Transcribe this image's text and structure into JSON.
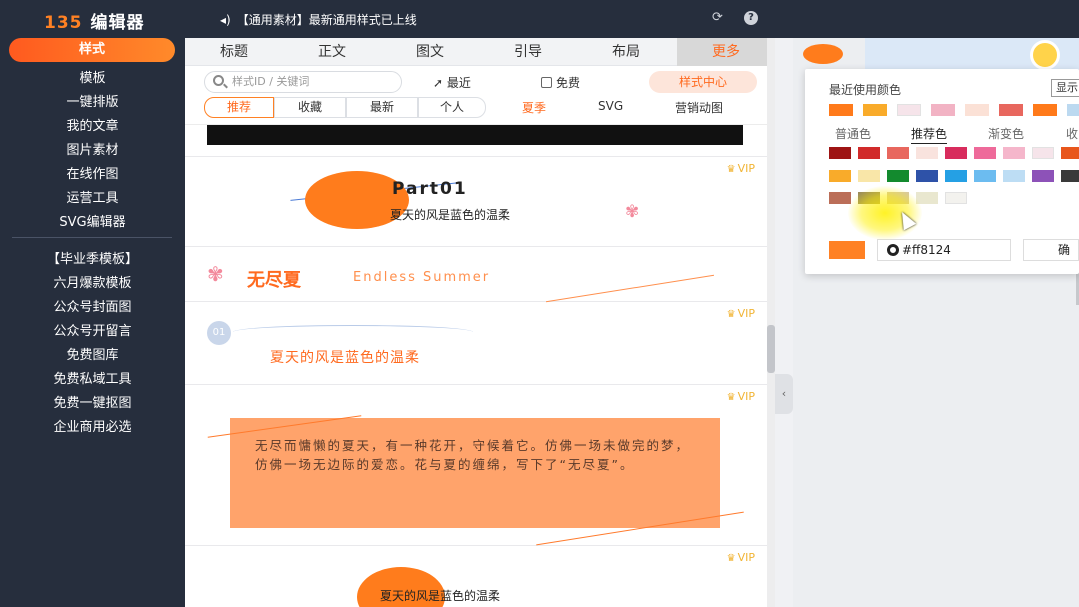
{
  "app": {
    "logo": "135",
    "title": "编辑器",
    "notice_icon": "speaker-icon",
    "notice": "【通用素材】最新通用样式已上线"
  },
  "sidebar": {
    "items": [
      "样式",
      "模板",
      "一键排版",
      "我的文章",
      "图片素材",
      "在线作图",
      "运营工具",
      "SVG编辑器"
    ],
    "items2": [
      "【毕业季模板】",
      "六月爆款模板",
      "公众号封面图",
      "公众号开留言",
      "免费图库",
      "免费私域工具",
      "免费一键抠图",
      "企业商用必选"
    ]
  },
  "panel": {
    "tabs": [
      "标题",
      "正文",
      "图文",
      "引导",
      "布局",
      "更多"
    ],
    "search_placeholder": "样式ID / 关键词",
    "recent": "最近",
    "free": "免费",
    "style_center": "样式中心",
    "subtabs": [
      "推荐",
      "收藏",
      "最新",
      "个人"
    ],
    "subtexts": [
      "夏季",
      "SVG",
      "营销动图"
    ]
  },
  "cards": {
    "vip": "VIP",
    "part01": {
      "title": "Part01",
      "subtitle": "夏天的风是蓝色的温柔"
    },
    "endless": {
      "cn": "无尽夏",
      "en": "Endless Summer"
    },
    "num1": {
      "badge": "01",
      "text": "夏天的风是蓝色的温柔"
    },
    "box": {
      "text": "无尽而慵懒的夏天，有一种花开，守候着它。仿佛一场未做完的梦，仿佛一场无边际的爱恋。花与夏的缠绵，写下了“无尽夏”。"
    },
    "last": {
      "text": "夏天的风是蓝色的温柔"
    }
  },
  "picker": {
    "recent_label": "最近使用颜色",
    "show_label": "显示",
    "tabs": [
      "普通色",
      "推荐色",
      "渐变色",
      "收"
    ],
    "current_hex": "#ff8124",
    "confirm": "确"
  },
  "colors": {
    "accent": "#ff8124",
    "recent": [
      "#ff7a1a",
      "#f9ab2a",
      "#f6e4ea",
      "#f2b3c4",
      "#fbe1d6",
      "#e8675e",
      "#ff7a1a",
      "#bcd9f0"
    ],
    "row1": [
      "#9e1414",
      "#d12a2a",
      "#e8675e",
      "#f9e3de",
      "#d82c5d",
      "#ee6a9a",
      "#f5b6cb",
      "#f6e4ea",
      "#e8561c"
    ],
    "row2": [
      "#f9ab2a",
      "#f9e6a8",
      "#138a2e",
      "#2e52a8",
      "#25a0e4",
      "#6cbcf0",
      "#bdddf4",
      "#8d52b8",
      "#3a3a3a"
    ],
    "row3": [
      "#bb6e58",
      "#9c8d5a",
      "#d7c7a4",
      "#e9e7cf",
      "#f3f2ee"
    ]
  }
}
